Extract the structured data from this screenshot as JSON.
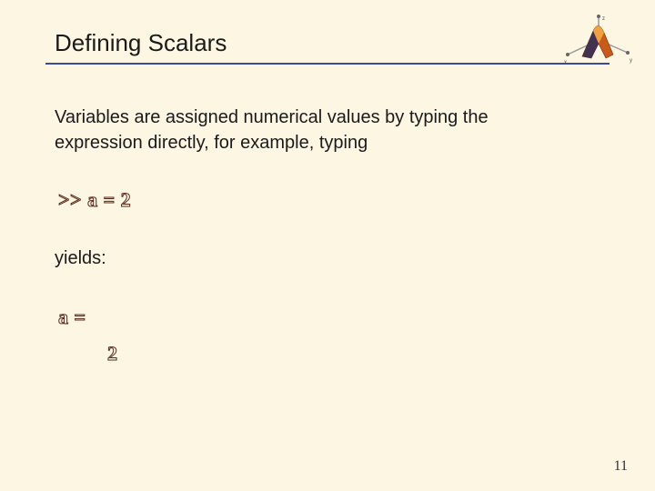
{
  "slide": {
    "title": "Defining Scalars",
    "intro": "Variables are assigned numerical values by typing the expression directly, for example, typing",
    "command": ">>  a = 2",
    "yields": "yields:",
    "result_var": "a =",
    "result_val": "2",
    "page_number": "11"
  }
}
